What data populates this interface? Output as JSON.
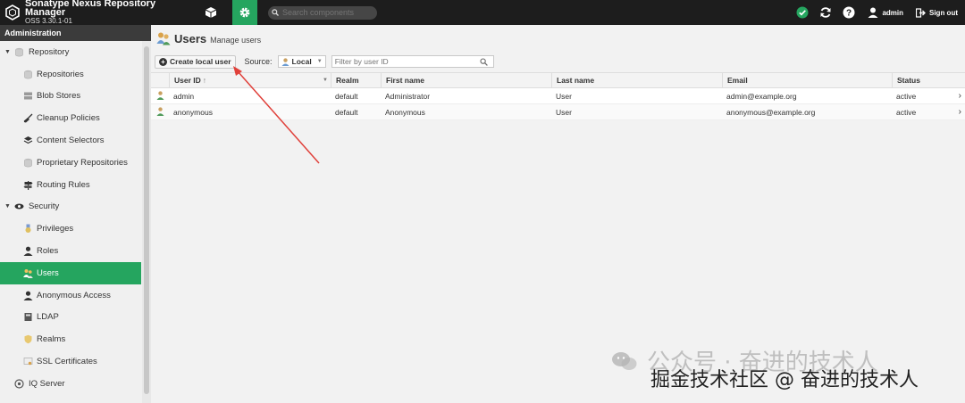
{
  "app": {
    "title": "Sonatype Nexus Repository Manager",
    "version": "OSS 3.30.1-01",
    "search_placeholder": "Search components",
    "user": "admin",
    "signout": "Sign out"
  },
  "sidebar": {
    "header": "Administration",
    "items": [
      {
        "label": "Repository",
        "kind": "group",
        "icon": "database-icon"
      },
      {
        "label": "Repositories",
        "kind": "child",
        "icon": "database-icon"
      },
      {
        "label": "Blob Stores",
        "kind": "child",
        "icon": "server-icon"
      },
      {
        "label": "Cleanup Policies",
        "kind": "child",
        "icon": "broom-icon"
      },
      {
        "label": "Content Selectors",
        "kind": "child",
        "icon": "layers-icon"
      },
      {
        "label": "Proprietary Repositories",
        "kind": "child",
        "icon": "database-icon"
      },
      {
        "label": "Routing Rules",
        "kind": "child",
        "icon": "signpost-icon"
      },
      {
        "label": "Security",
        "kind": "group",
        "icon": "eye-icon"
      },
      {
        "label": "Privileges",
        "kind": "child",
        "icon": "medal-icon"
      },
      {
        "label": "Roles",
        "kind": "child",
        "icon": "user-icon"
      },
      {
        "label": "Users",
        "kind": "child",
        "icon": "users-icon",
        "active": true
      },
      {
        "label": "Anonymous Access",
        "kind": "child",
        "icon": "user-icon"
      },
      {
        "label": "LDAP",
        "kind": "child",
        "icon": "book-icon"
      },
      {
        "label": "Realms",
        "kind": "child",
        "icon": "shield-icon"
      },
      {
        "label": "SSL Certificates",
        "kind": "child",
        "icon": "certificate-icon"
      },
      {
        "label": "IQ Server",
        "kind": "group-noexpand",
        "icon": "iq-icon"
      }
    ]
  },
  "page": {
    "title": "Users",
    "subtitle": "Manage users",
    "create_button": "Create local user",
    "source_label": "Source:",
    "source_value": "Local",
    "filter_placeholder": "Filter by user ID"
  },
  "grid": {
    "columns": [
      "User ID",
      "Realm",
      "First name",
      "Last name",
      "Email",
      "Status"
    ],
    "sort_indicator": "↑",
    "rows": [
      {
        "user_id": "admin",
        "realm": "default",
        "first": "Administrator",
        "last": "User",
        "email": "admin@example.org",
        "status": "active"
      },
      {
        "user_id": "anonymous",
        "realm": "default",
        "first": "Anonymous",
        "last": "User",
        "email": "anonymous@example.org",
        "status": "active"
      }
    ]
  },
  "watermark": {
    "line1": "公众号 · 奋进的技术人",
    "line2": "掘金技术社区 @ 奋进的技术人"
  },
  "colors": {
    "accent": "#25a55f",
    "topbar": "#1d1d1d",
    "annotation": "#e0403a"
  }
}
